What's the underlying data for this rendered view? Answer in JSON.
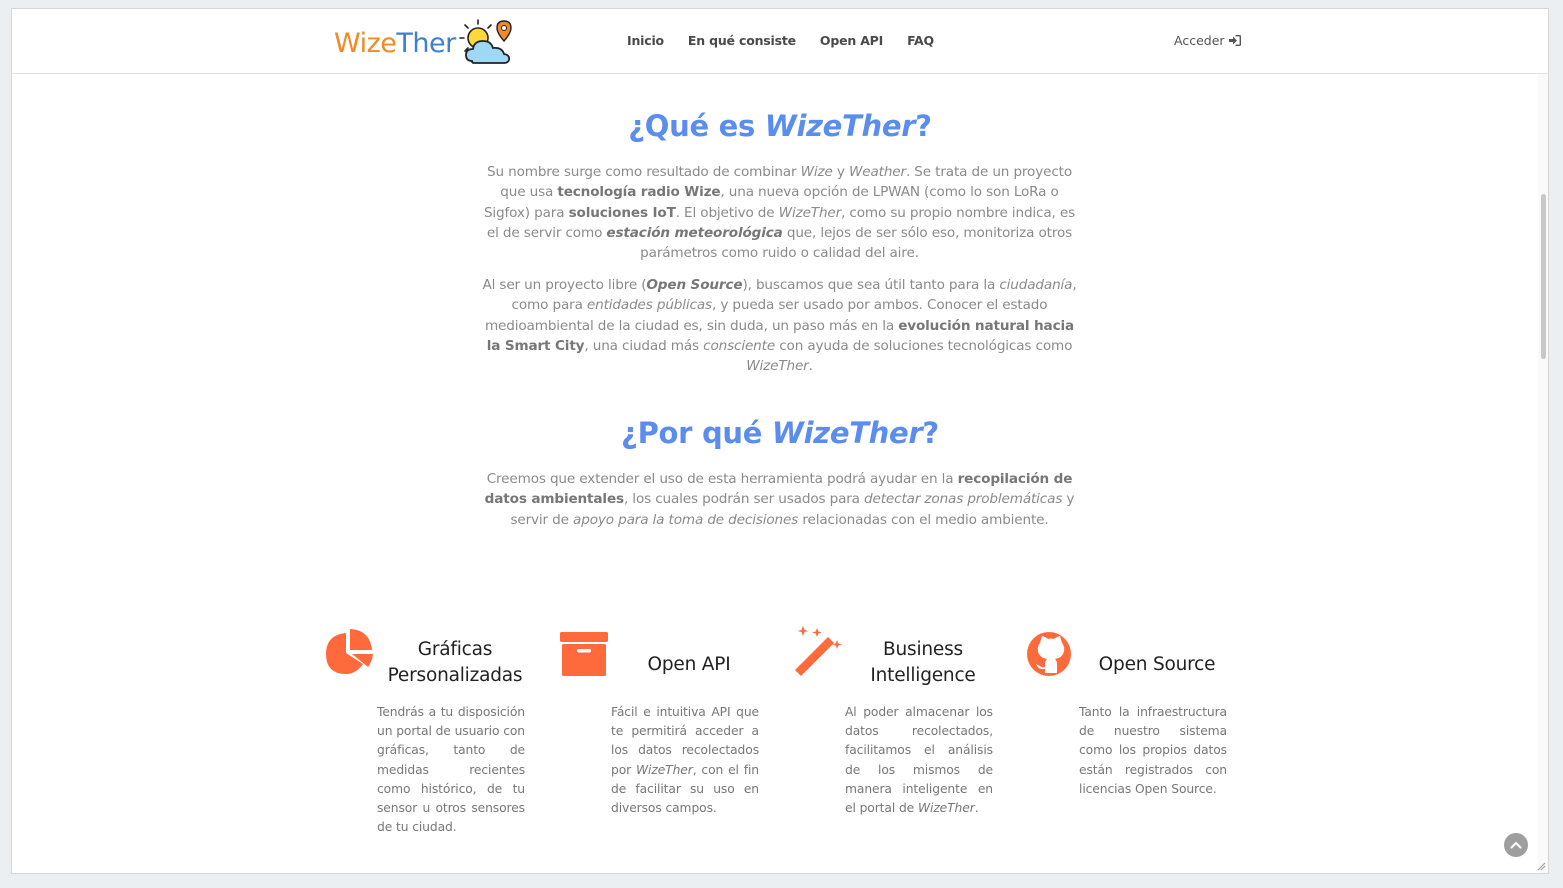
{
  "header": {
    "logo": {
      "part1": "Wize",
      "part2": "Ther"
    },
    "nav": [
      "Inicio",
      "En qué consiste",
      "Open API",
      "FAQ"
    ],
    "login_label": "Acceder"
  },
  "what": {
    "title_prefix": "¿Qué es ",
    "title_em": "WizeTher",
    "title_suffix": "?",
    "p1": [
      {
        "t": "Su nombre surge como resultado de combinar "
      },
      {
        "t": "Wize",
        "s": "em"
      },
      {
        "t": " y "
      },
      {
        "t": "Weather",
        "s": "em"
      },
      {
        "t": ". Se trata de un proyecto que usa "
      },
      {
        "t": "tecnología radio Wize",
        "s": "b"
      },
      {
        "t": ", una nueva opción de LPWAN (como lo son LoRa o Sigfox) para "
      },
      {
        "t": "soluciones IoT",
        "s": "b"
      },
      {
        "t": ". El objetivo de "
      },
      {
        "t": "WizeTher",
        "s": "em"
      },
      {
        "t": ", como su propio nombre indica, es el de servir como "
      },
      {
        "t": "estación meteorológica",
        "s": "bem"
      },
      {
        "t": " que, lejos de ser sólo eso, monitoriza otros parámetros como ruido o calidad del aire."
      }
    ],
    "p2": [
      {
        "t": "Al ser un proyecto libre ("
      },
      {
        "t": "Open Source",
        "s": "bem"
      },
      {
        "t": "), buscamos que sea útil tanto para la "
      },
      {
        "t": "ciudadanía",
        "s": "em"
      },
      {
        "t": ", como para "
      },
      {
        "t": "entidades públicas",
        "s": "em"
      },
      {
        "t": ", y pueda ser usado por ambos. Conocer el estado medioambiental de la ciudad es, sin duda, un paso más en la "
      },
      {
        "t": "evolución natural hacia la Smart City",
        "s": "b"
      },
      {
        "t": ", una ciudad más "
      },
      {
        "t": "consciente",
        "s": "em"
      },
      {
        "t": " con ayuda de soluciones tecnológicas como "
      },
      {
        "t": "WizeTher",
        "s": "em"
      },
      {
        "t": "."
      }
    ]
  },
  "why": {
    "title_prefix": "¿Por qué ",
    "title_em": "WizeTher",
    "title_suffix": "?",
    "p1": [
      {
        "t": "Creemos que extender el uso de esta herramienta podrá ayudar en la "
      },
      {
        "t": "recopilación de datos ambientales",
        "s": "b"
      },
      {
        "t": ", los cuales podrán ser usados para "
      },
      {
        "t": "detectar zonas problemáticas",
        "s": "em"
      },
      {
        "t": " y servir de "
      },
      {
        "t": "apoyo para la toma de decisiones",
        "s": "em"
      },
      {
        "t": " relacionadas con el medio ambiente."
      }
    ]
  },
  "features": [
    {
      "icon": "pie-chart-icon",
      "title": "Gráficas Personalizadas",
      "desc": [
        {
          "t": "Tendrás a tu disposición un portal de usuario con gráficas, tanto de medidas recientes como histórico, de tu sensor u otros sensores de tu ciudad."
        }
      ]
    },
    {
      "icon": "archive-box-icon",
      "title": "Open API",
      "desc": [
        {
          "t": "Fácil e intuitiva API que te permitirá acceder a los datos recolectados por "
        },
        {
          "t": "WizeTher",
          "s": "em"
        },
        {
          "t": ", con el fin de facilitar su uso en diversos campos."
        }
      ]
    },
    {
      "icon": "magic-wand-icon",
      "title": "Business Intelligence",
      "desc": [
        {
          "t": "Al poder almacenar los datos recolectados, facilitamos el análisis de los mismos de manera inteligente en el portal de "
        },
        {
          "t": "WizeTher",
          "s": "em"
        },
        {
          "t": "."
        }
      ]
    },
    {
      "icon": "github-icon",
      "title": "Open Source",
      "desc": [
        {
          "t": "Tanto la infraestructura de nuestro sistema como los propios datos están registrados con licencias Open Source."
        }
      ]
    }
  ],
  "colors": {
    "accent": "#5b8def",
    "icon": "#ff6a3d",
    "logo_orange": "#f08a24",
    "logo_blue": "#3d7fd0"
  }
}
